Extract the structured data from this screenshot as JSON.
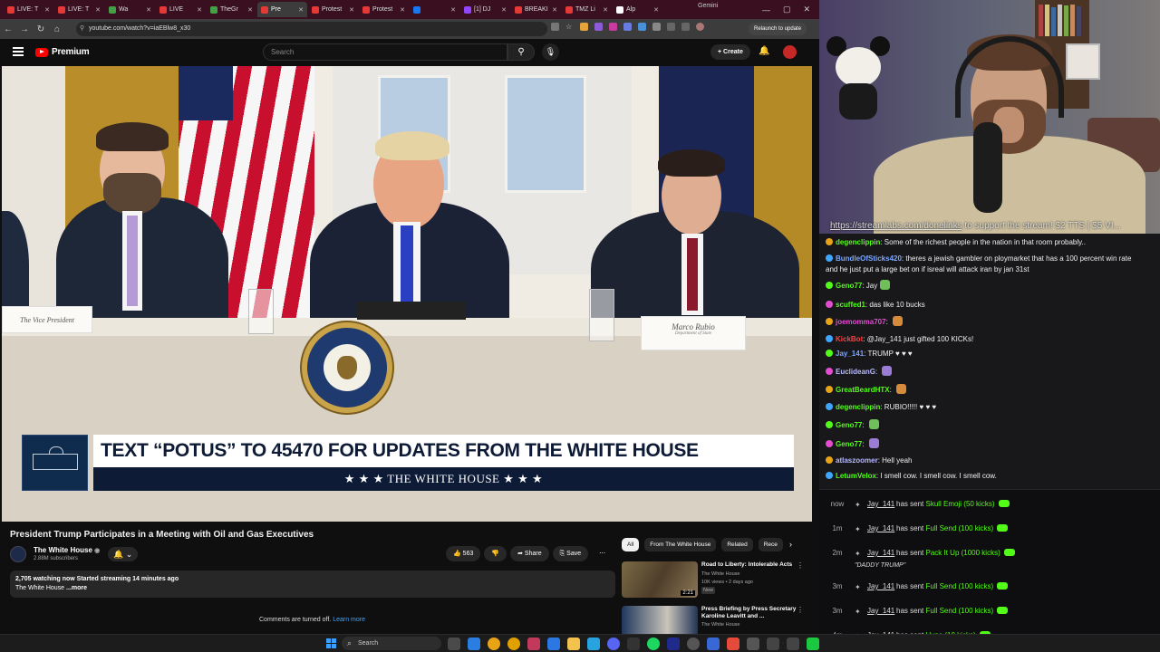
{
  "browser": {
    "tabs": [
      "LIVE: T",
      "LIVE: T",
      "Wa",
      "LIVE",
      "TheGr",
      "Pre",
      "Protest",
      "Protest",
      "",
      "[1] DJ",
      "BREAKI",
      "TMZ Li",
      "Alp"
    ],
    "gemini_label": "Gemini",
    "url": "youtube.com/watch?v=iaEBlw8_x30",
    "relaunch_label": "Relaunch to update",
    "tab_colors": [
      "#e53935",
      "#e53935",
      "#43a047",
      "#e53935",
      "#43a047",
      "#e53935",
      "#e53935",
      "#e53935",
      "#1877f2",
      "#9146ff",
      "#e53935",
      "#e53935",
      "#ffffff"
    ]
  },
  "youtube": {
    "logo_text": "Premium",
    "search_placeholder": "Search",
    "create_label": "Create",
    "video": {
      "lower_third_headline": "TEXT “POTUS” TO 45470 FOR UPDATES FROM THE WHITE HOUSE",
      "lower_third_bar": "★ ★ ★   THE WHITE HOUSE   ★ ★ ★",
      "namecard_left": "The Vice President",
      "namecard_right": "Marco Rubio",
      "namecard_right_sub": "Department of State"
    },
    "title": "President Trump Participates in a Meeting with Oil and Gas Executives",
    "channel": {
      "name": "The White House",
      "subscribers": "2.88M subscribers"
    },
    "actions": {
      "likes": "563",
      "share": "Share",
      "save": "Save"
    },
    "meta": {
      "line1": "2,705 watching now  Started streaming 14 minutes ago",
      "line2": "The White House",
      "more": "...more"
    },
    "comments_notice": "Comments are turned off.",
    "learn_more": "Learn more",
    "rec_tabs": [
      "All",
      "From The White House",
      "Related",
      "Rece"
    ],
    "recommendations": [
      {
        "title": "Road to Liberty: Intolerable Acts",
        "channel": "The White House",
        "stats": "10K views • 2 days ago",
        "badge": "New",
        "duration": "2:21"
      },
      {
        "title": "Press Briefing by Press Secretary Karoline Leavitt and ...",
        "channel": "The White House",
        "stats": "",
        "badge": "",
        "duration": ""
      }
    ]
  },
  "stream_overlay": {
    "link": "https://streamlabs.com/donelinks",
    "suffix": "to support the stream! $2 TTS | $5 VI..."
  },
  "chat": [
    {
      "user": "degenclippin",
      "color": "#53fc18",
      "text": "Some of the richest people in the nation in that room probably.."
    },
    {
      "user": "BundleOfSticks420",
      "color": "#7aa7ff",
      "text": "theres a jewish gambler on ploymarket that has a 100 percent win rate and he just put a large bet on if isreal will attack iran by jan 31st"
    },
    {
      "user": "Geno77",
      "color": "#53fc18",
      "text": "Jay"
    },
    {
      "user": "scuffed1",
      "color": "#53fc18",
      "text": "das like 10 bucks"
    },
    {
      "user": "joemomma707",
      "color": "#e24dd0",
      "text": ""
    },
    {
      "user": "KickBot",
      "color": "#ff4040",
      "text": "@Jay_141 just gifted 100 KICKs!"
    },
    {
      "user": "Jay_141",
      "color": "#7aa7ff",
      "text": "TRUMP ♥ ♥ ♥"
    },
    {
      "user": "EuclideanG",
      "color": "#b9b9ff",
      "text": ""
    },
    {
      "user": "GreatBeardHTX",
      "color": "#53fc18",
      "text": ""
    },
    {
      "user": "degenclippin",
      "color": "#53fc18",
      "text": "RUBIO!!!!! ♥ ♥ ♥"
    },
    {
      "user": "Geno77",
      "color": "#53fc18",
      "text": ""
    },
    {
      "user": "Geno77",
      "color": "#53fc18",
      "text": ""
    },
    {
      "user": "atlaszoomer",
      "color": "#b9b9ff",
      "text": "Hell yeah"
    },
    {
      "user": "LetumVelox",
      "color": "#53fc18",
      "text": "I smell cow. I smell cow. I smell cow."
    }
  ],
  "kick_feed": [
    {
      "time": "now",
      "user": "Jay_141",
      "verb": "has sent",
      "item": "Skull Emoji (50 kicks)",
      "note": ""
    },
    {
      "time": "1m",
      "user": "Jay_141",
      "verb": "has sent",
      "item": "Full Send (100 kicks)",
      "note": ""
    },
    {
      "time": "2m",
      "user": "Jay_141",
      "verb": "has sent",
      "item": "Pack It Up (1000 kicks)",
      "note": "\"DADDY TRUMP\""
    },
    {
      "time": "3m",
      "user": "Jay_141",
      "verb": "has sent",
      "item": "Full Send (100 kicks)",
      "note": ""
    },
    {
      "time": "3m",
      "user": "Jay_141",
      "verb": "has sent",
      "item": "Full Send (100 kicks)",
      "note": ""
    },
    {
      "time": "4m",
      "user": "Jay_141",
      "verb": "has sent",
      "item": "Hype (10 kicks)",
      "note": ""
    }
  ],
  "taskbar": {
    "search_placeholder": "Search"
  }
}
